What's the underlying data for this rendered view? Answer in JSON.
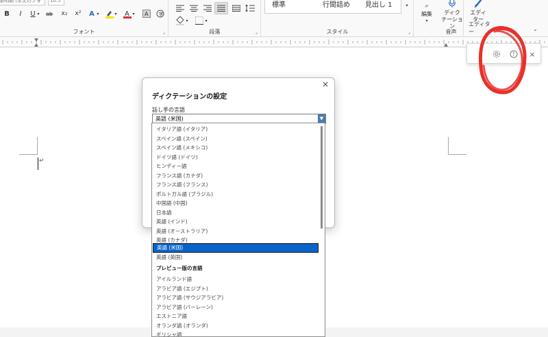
{
  "ribbon": {
    "font_name": "游明朝 (本文のフォント)",
    "font_size": "10.5",
    "groups": {
      "font": "フォント",
      "paragraph": "段落",
      "style": "スタイル",
      "voice": "音声",
      "editor": "エディター"
    },
    "styles": [
      "標準",
      "行間詰め",
      "見出し 1"
    ],
    "buttons": {
      "edit": "編集",
      "dictation_line1": "ディク",
      "dictation_line2": "テーション",
      "editor_line1": "エディ",
      "editor_line2": "ター"
    },
    "colors": {
      "highlight": "#f2e500",
      "font_color": "#d13438"
    }
  },
  "dialog": {
    "title": "ディクテーションの設定",
    "close_symbol": "×",
    "language_label": "話し手の言語",
    "selected_language": "英語 (米国)"
  },
  "language_list": {
    "items": [
      "イタリア語 (イタリア)",
      "スペイン語 (スペイン)",
      "スペイン語 (メキシコ)",
      "ドイツ語 (ドイツ)",
      "ヒンディー語",
      "フランス語 (カナダ)",
      "フランス語 (フランス)",
      "ポルトガル語 (ブラジル)",
      "中国語 (中国)",
      "日本語",
      "英語 (インド)",
      "英語 (オーストラリア)",
      "英語 (カナダ)"
    ],
    "selected": "英語 (米国)",
    "after_selected": [
      "英語 (英国)"
    ],
    "preview_header": "プレビュー版の言語",
    "preview_items": [
      "アイルランド語",
      "アラビア語 (エジプト)",
      "アラビア語 (サウジアラビア)",
      "アラビア語 (バーレーン)",
      "エストニア語",
      "オランダ語 (オランダ)",
      "ギリシャ語"
    ]
  },
  "floating_toolbar": {
    "icons": [
      "gear-icon",
      "help-icon",
      "close-icon"
    ],
    "close_symbol": "×",
    "help_symbol": "?"
  },
  "annotation_color": "#e8302a"
}
